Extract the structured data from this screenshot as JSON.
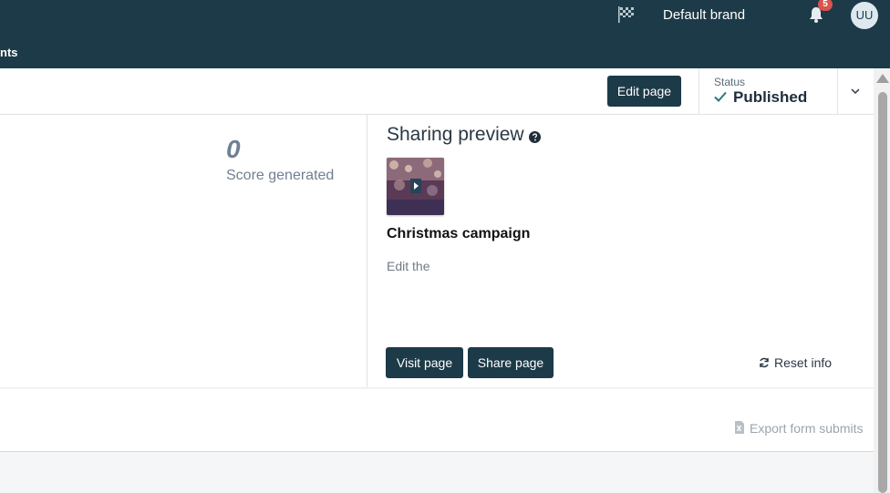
{
  "header": {
    "brand": "Default brand",
    "notification_count": "5",
    "avatar_initials": "UU",
    "nav_tab_partial": "nts"
  },
  "toolbar": {
    "edit_label": "Edit page",
    "status_label": "Status",
    "status_value": "Published"
  },
  "stats": {
    "score_value": "0",
    "score_label": "Score generated"
  },
  "sharing": {
    "title": "Sharing preview",
    "campaign_title": "Christmas campaign",
    "description": "Edit the",
    "visit_label": "Visit page",
    "share_label": "Share page",
    "reset_label": "Reset info"
  },
  "export": {
    "label": "Export form submits"
  },
  "colors": {
    "header_bg": "#1d3a48",
    "button_bg": "#1d3a48",
    "status_check": "#2a7a78",
    "badge": "#d9534f"
  }
}
